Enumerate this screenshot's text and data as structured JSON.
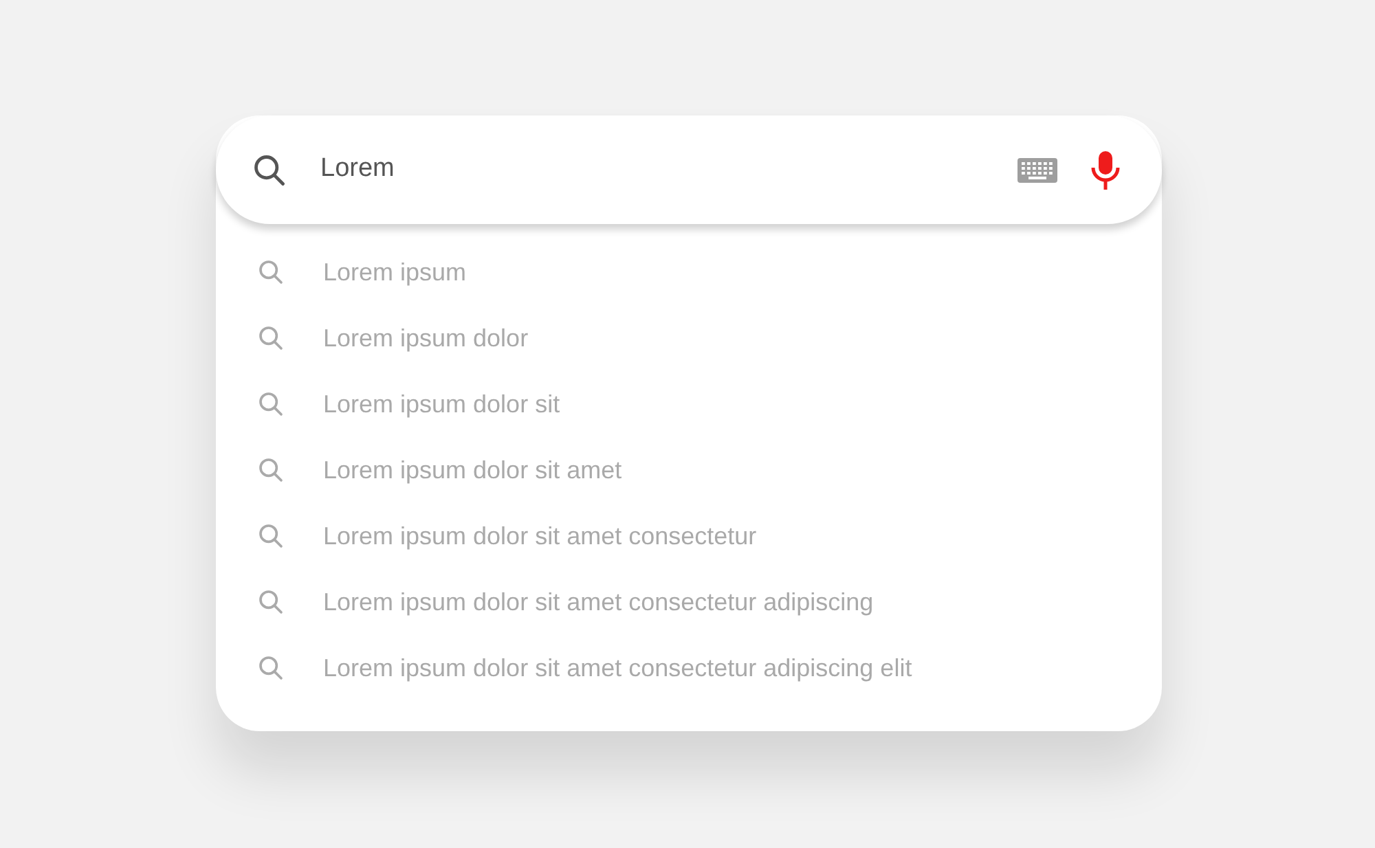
{
  "search": {
    "value": "Lorem"
  },
  "suggestions": [
    {
      "text": "Lorem ipsum"
    },
    {
      "text": "Lorem ipsum dolor"
    },
    {
      "text": "Lorem ipsum dolor sit"
    },
    {
      "text": "Lorem ipsum dolor sit amet"
    },
    {
      "text": "Lorem ipsum dolor sit amet consectetur"
    },
    {
      "text": "Lorem ipsum dolor sit amet consectetur adipiscing"
    },
    {
      "text": "Lorem ipsum dolor sit amet consectetur adipiscing elit"
    }
  ]
}
